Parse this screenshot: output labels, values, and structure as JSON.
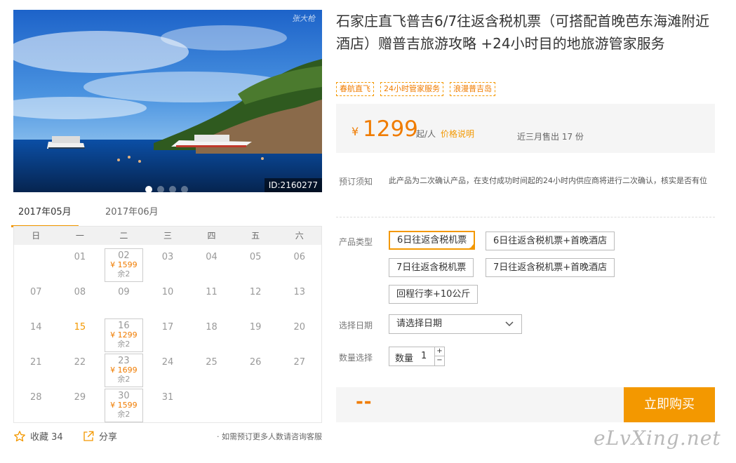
{
  "hero": {
    "id_label": "ID:2160277",
    "watermark": "张大枪",
    "slide_count": 4,
    "active_slide": 0
  },
  "calendar": {
    "months": [
      "2017年05月",
      "2017年06月"
    ],
    "weekdays": [
      "日",
      "一",
      "二",
      "三",
      "四",
      "五",
      "六"
    ],
    "days": [
      {
        "d": ""
      },
      {
        "d": "01"
      },
      {
        "d": "02",
        "price": "¥ 1599",
        "stock": "余2"
      },
      {
        "d": "03"
      },
      {
        "d": "04"
      },
      {
        "d": "05"
      },
      {
        "d": "06"
      },
      {
        "d": "07"
      },
      {
        "d": "08"
      },
      {
        "d": "09"
      },
      {
        "d": "10"
      },
      {
        "d": "11"
      },
      {
        "d": "12"
      },
      {
        "d": "13"
      },
      {
        "d": "14"
      },
      {
        "d": "15",
        "today": true
      },
      {
        "d": "16",
        "price": "¥ 1299",
        "stock": "余2"
      },
      {
        "d": "17"
      },
      {
        "d": "18"
      },
      {
        "d": "19"
      },
      {
        "d": "20"
      },
      {
        "d": "21"
      },
      {
        "d": "22"
      },
      {
        "d": "23",
        "price": "¥ 1699",
        "stock": "余2"
      },
      {
        "d": "24"
      },
      {
        "d": "25"
      },
      {
        "d": "26"
      },
      {
        "d": "27"
      },
      {
        "d": "28"
      },
      {
        "d": "29"
      },
      {
        "d": "30",
        "price": "¥ 1599",
        "stock": "余2"
      },
      {
        "d": "31"
      }
    ]
  },
  "footer": {
    "favorite_label": "收藏 34",
    "share_label": "分享",
    "consult_text": "· 如需预订更多人数请咨询客服"
  },
  "product": {
    "title": "石家庄直飞普吉6/7往返含税机票（可搭配首晚芭东海滩附近酒店）赠普吉旅游攻略 +24小时目的地旅游管家服务",
    "tags": [
      "春航直飞",
      "24小时管家服务",
      "浪漫普吉岛"
    ]
  },
  "price": {
    "symbol": "¥",
    "amount": "1299",
    "unit": "起/人",
    "explain": "价格说明",
    "sold": "近三月售出 17 份"
  },
  "notice": {
    "label": "预订须知",
    "text": "此产品为二次确认产品，在支付成功时间起的24小时内供应商将进行二次确认，核实是否有位"
  },
  "options": {
    "label": "产品类型",
    "items": [
      "6日往返含税机票",
      "6日往返含税机票+首晚酒店",
      "7日往返含税机票",
      "7日往返含税机票+首晚酒店",
      "回程行李+10公斤"
    ],
    "selected": 0
  },
  "date": {
    "label": "选择日期",
    "placeholder": "请选择日期"
  },
  "quantity": {
    "label": "数量选择",
    "prefix": "数量",
    "value": "1",
    "plus": "+",
    "minus": "−"
  },
  "buy": {
    "total": "--",
    "button": "立即购买"
  },
  "site_watermark": "eLvXing.net",
  "colors": {
    "accent": "#f39800",
    "price": "#f07c00"
  }
}
